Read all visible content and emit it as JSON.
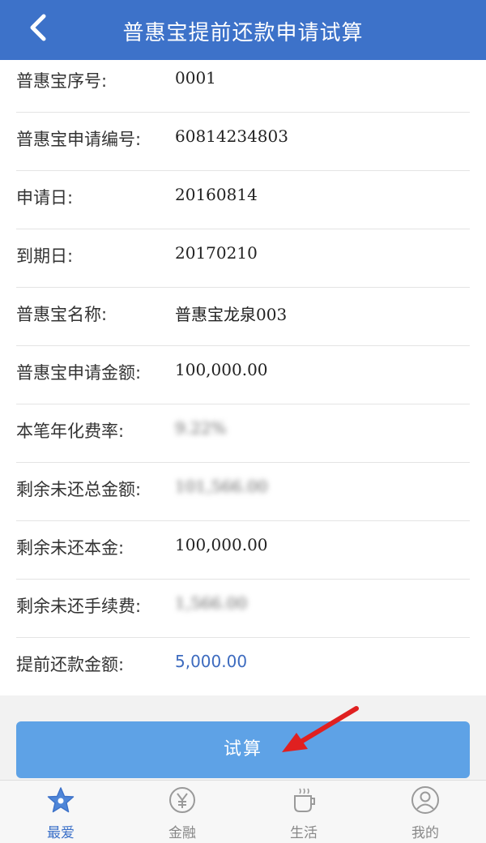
{
  "header": {
    "title": "普惠宝提前还款申请试算",
    "back_icon": "chevron-left-icon"
  },
  "fields": [
    {
      "label": "普惠宝序号:",
      "value": "0001"
    },
    {
      "label": "普惠宝申请编号:",
      "value": "60814234803"
    },
    {
      "label": "申请日:",
      "value": "20160814"
    },
    {
      "label": "到期日:",
      "value": "20170210"
    },
    {
      "label": "普惠宝名称:",
      "value": "普惠宝龙泉003"
    },
    {
      "label": "普惠宝申请金额:",
      "value": "100,000.00"
    },
    {
      "label": "本笔年化费率:",
      "value": "9.22%"
    },
    {
      "label": "剩余未还总金额:",
      "value": "101,566.00"
    },
    {
      "label": "剩余未还本金:",
      "value": "100,000.00"
    },
    {
      "label": "剩余未还手续费:",
      "value": "1,566.00"
    },
    {
      "label": "提前还款金额:",
      "value": "5,000.00"
    }
  ],
  "calc_button": {
    "label": "试算"
  },
  "tabs": [
    {
      "label": "最爱",
      "icon": "star-icon",
      "active": true
    },
    {
      "label": "金融",
      "icon": "yen-icon",
      "active": false
    },
    {
      "label": "生活",
      "icon": "cup-icon",
      "active": false
    },
    {
      "label": "我的",
      "icon": "person-icon",
      "active": false
    }
  ],
  "colors": {
    "primary": "#3d72c9",
    "button": "#5ea2e6",
    "accent_value": "#3d6bbf",
    "annotation": "#e02020"
  }
}
